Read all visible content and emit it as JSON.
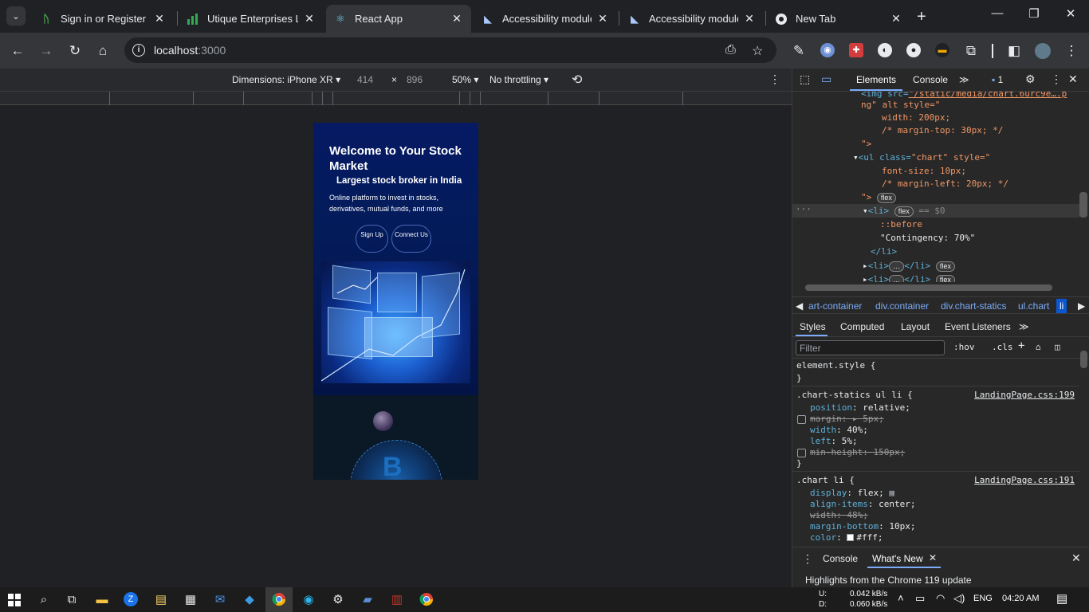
{
  "browser": {
    "tabs": [
      {
        "title": "Sign in or Register | A",
        "icon": "sign-in-favicon",
        "active": false
      },
      {
        "title": "Utique Enterprises Ltd",
        "icon": "bar-chart-favicon",
        "active": false
      },
      {
        "title": "React App",
        "icon": "react-favicon",
        "active": true
      },
      {
        "title": "Accessibility module",
        "icon": "accessibility-favicon",
        "active": false
      },
      {
        "title": "Accessibility module",
        "icon": "accessibility-favicon",
        "active": false
      },
      {
        "title": "New Tab",
        "icon": "chrome-favicon",
        "active": false
      }
    ],
    "url_host": "localhost",
    "url_port": ":3000"
  },
  "device_toolbar": {
    "dimensions": "Dimensions: iPhone XR",
    "width": "414",
    "times": "×",
    "height": "896",
    "zoom": "50%",
    "throttling": "No throttling"
  },
  "page": {
    "headline": "Welcome to Your Stock Market",
    "subheadline": "Largest stock broker in India",
    "description": "Online platform to invest in stocks, derivatives, mutual funds, and more",
    "signup_label": "Sign Up",
    "connect_label": "Connect Us"
  },
  "devtools": {
    "tabs": {
      "elements": "Elements",
      "console": "Console",
      "more": "≫"
    },
    "issues_count": "1",
    "elements_lines": {
      "l1_tag": "<img src=",
      "l1_val": "\"/static/media/chart.6urc9e….p",
      "l2": "ng\" alt style=\"",
      "l3": "width: 200px;",
      "l4": "/* margin-top: 30px; */",
      "l5": "\">",
      "l6_tag": "<ul class=",
      "l6_val": "\"chart\"",
      "l6_attr": " style=\"",
      "l7": "font-size: 10px;",
      "l8": "/* margin-left: 20px; */",
      "l9": "\">",
      "l10_tag": "<li>",
      "l10_eq": "== $0",
      "l11": "::before",
      "l12": "\"Contingency: 70%\"",
      "l13": "</li>",
      "l14": "<li>",
      "l14_end": "</li>",
      "l15": "<li>",
      "l15_end": "</li>",
      "flex": "flex",
      "dots": "···",
      "ellipsis": "…"
    },
    "breadcrumbs": [
      "art-container",
      "div.container",
      "div.chart-statics",
      "ul.chart",
      "li"
    ],
    "subtabs": [
      "Styles",
      "Computed",
      "Layout",
      "Event Listeners",
      "≫"
    ],
    "filter_placeholder": "Filter",
    "hov": ":hov",
    "cls": ".cls",
    "styles": {
      "element_style": "element.style {",
      "close": "}",
      "rule1_selector": ".chart-statics ul li {",
      "rule1_source": "LandingPage.css:199",
      "rule1_position": "position",
      "rule1_position_val": "relative;",
      "rule1_margin": "margin: ▸ 5px;",
      "rule1_width": "width",
      "rule1_width_val": "40%;",
      "rule1_left": "left",
      "rule1_left_val": "5%;",
      "rule1_minheight": "min-height: 150px;",
      "rule2_selector": ".chart li {",
      "rule2_source": "LandingPage.css:191",
      "rule2_display": "display",
      "rule2_display_val": "flex;",
      "rule2_align": "align-items",
      "rule2_align_val": "center;",
      "rule2_width": "width: 48%;",
      "rule2_marginb": "margin-bottom",
      "rule2_marginb_val": "10px;",
      "rule2_color": "color",
      "rule2_color_val": "#fff;"
    },
    "drawer": {
      "console": "Console",
      "whatsnew": "What's New",
      "highlights": "Highlights from the Chrome 119 update"
    }
  },
  "taskbar": {
    "upload_label": "U:",
    "upload": "0.042 kB/s",
    "download_label": "D:",
    "download": "0.060 kB/s",
    "language": "ENG",
    "time": "04:20 AM"
  }
}
